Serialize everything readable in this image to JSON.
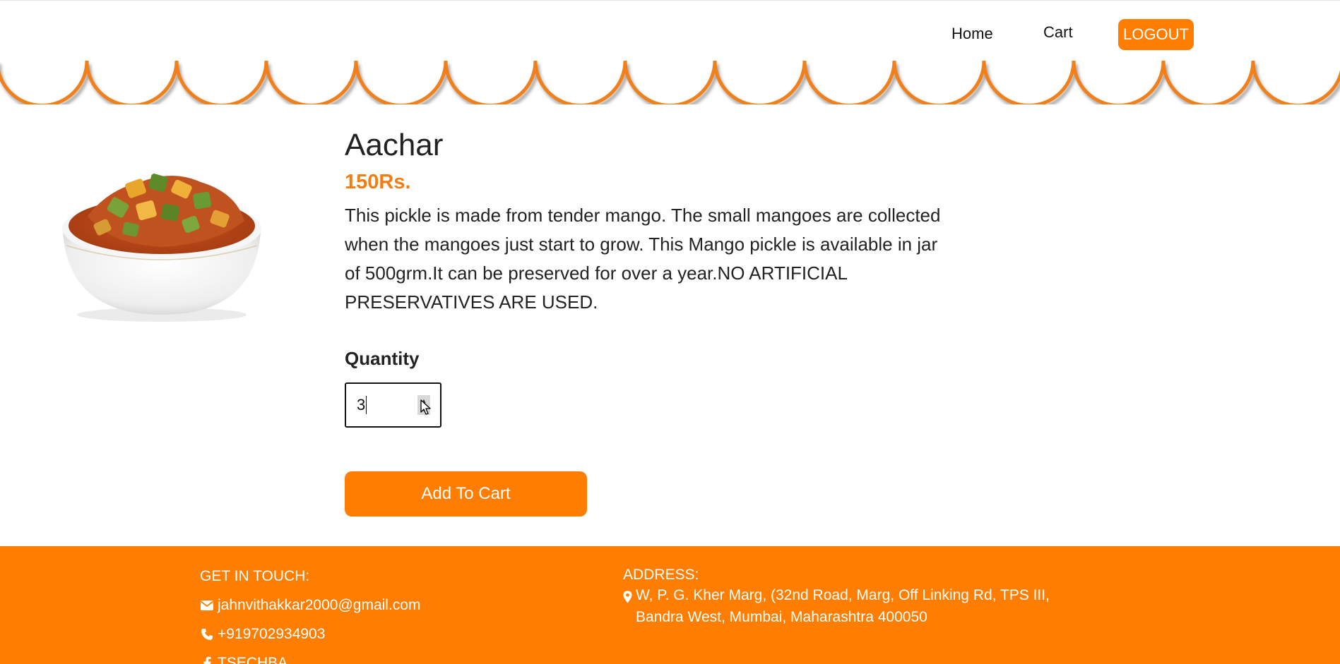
{
  "nav": {
    "home_label": "Home",
    "cart_label": "Cart",
    "logout_label": "LOGOUT"
  },
  "product": {
    "title": "Aachar",
    "price": "150Rs.",
    "description": "This pickle is made from tender mango. The small mangoes are collected when the mangoes just start to grow. This Mango pickle is available in jar of 500grm.It can be preserved for over a year.NO ARTIFICIAL PRESERVATIVES ARE USED.",
    "quantity_label": "Quantity",
    "quantity_value": "3",
    "add_to_cart_label": "Add To Cart"
  },
  "footer": {
    "contact_heading": "GET IN TOUCH:",
    "email": "jahnvithakkar2000@gmail.com",
    "phone": "+919702934903",
    "facebook": "TSECHBA",
    "address_heading": "ADDRESS:",
    "address": "W, P. G. Kher Marg, (32nd Road, Marg, Off Linking Rd, TPS III, Bandra West, Mumbai, Maharashtra 400050"
  },
  "colors": {
    "accent": "#ff7d00",
    "price": "#f07e13"
  },
  "icons": [
    "envelope-icon",
    "phone-icon",
    "facebook-icon",
    "map-marker-icon",
    "spin-up-icon",
    "spin-down-icon",
    "mouse-cursor-icon"
  ]
}
